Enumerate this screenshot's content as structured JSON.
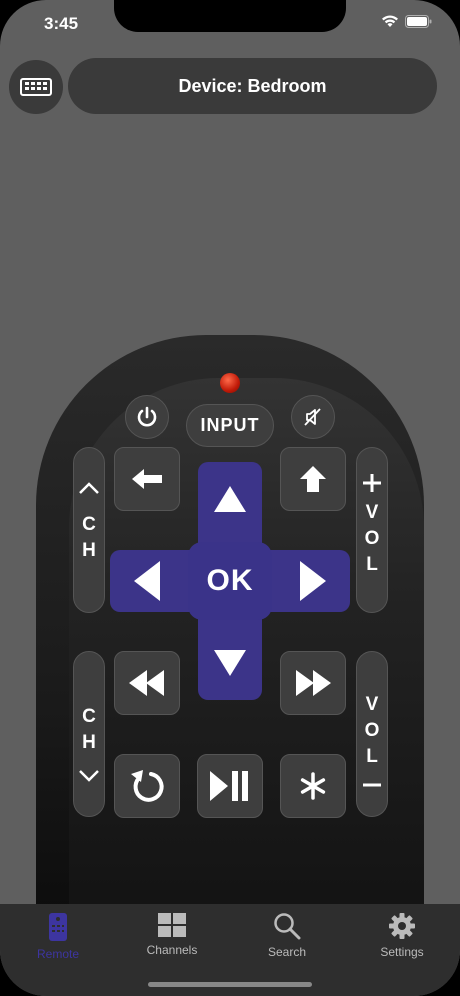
{
  "status_bar": {
    "time": "3:45"
  },
  "header": {
    "device_label": "Device: Bedroom"
  },
  "remote": {
    "input_label": "INPUT",
    "ch_up_label": "C\nH",
    "ch_down_label": "C\nH",
    "vol_up_label": "V\nO\nL",
    "vol_down_label": "V\nO\nL",
    "ok_label": "OK",
    "accent_color": "#3c3489"
  },
  "tabs": [
    {
      "label": "Remote",
      "icon": "remote-icon",
      "active": true
    },
    {
      "label": "Channels",
      "icon": "grid-icon",
      "active": false
    },
    {
      "label": "Search",
      "icon": "search-icon",
      "active": false
    },
    {
      "label": "Settings",
      "icon": "gear-icon",
      "active": false
    }
  ]
}
